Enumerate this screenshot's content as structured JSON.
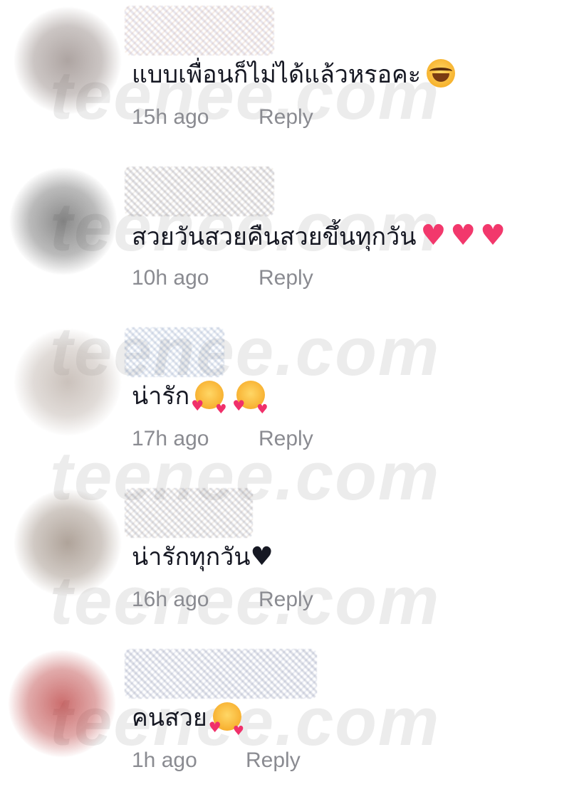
{
  "watermark": {
    "text": "teenee.com"
  },
  "comments": [
    {
      "text": "แบบเพื่อนก็ไม่ได้แล้วหรอคะ",
      "emojis": [
        "face-with-tears-of-joy"
      ],
      "time": "15h ago",
      "reply_label": "Reply",
      "avatar_color": "#6b5a55"
    },
    {
      "text": "สวยวันสวยคืนสวยขึ้นทุกวัน",
      "emojis": [
        "red-heart",
        "red-heart",
        "red-heart"
      ],
      "time": "10h ago",
      "reply_label": "Reply",
      "avatar_color": "#4a4a4a"
    },
    {
      "text": "น่ารัก",
      "emojis": [
        "smiling-face-with-hearts",
        "smiling-face-with-hearts"
      ],
      "time": "17h ago",
      "reply_label": "Reply",
      "avatar_color": "#a8998f"
    },
    {
      "text": "น่ารักทุกวัน",
      "emojis": [
        "black-heart"
      ],
      "time": "16h ago",
      "reply_label": "Reply",
      "avatar_color": "#7a6656"
    },
    {
      "text": "คนสวย",
      "emojis": [
        "smiling-face-with-hearts"
      ],
      "time": "1h ago",
      "reply_label": "Reply",
      "avatar_color": "#b02020"
    }
  ]
}
